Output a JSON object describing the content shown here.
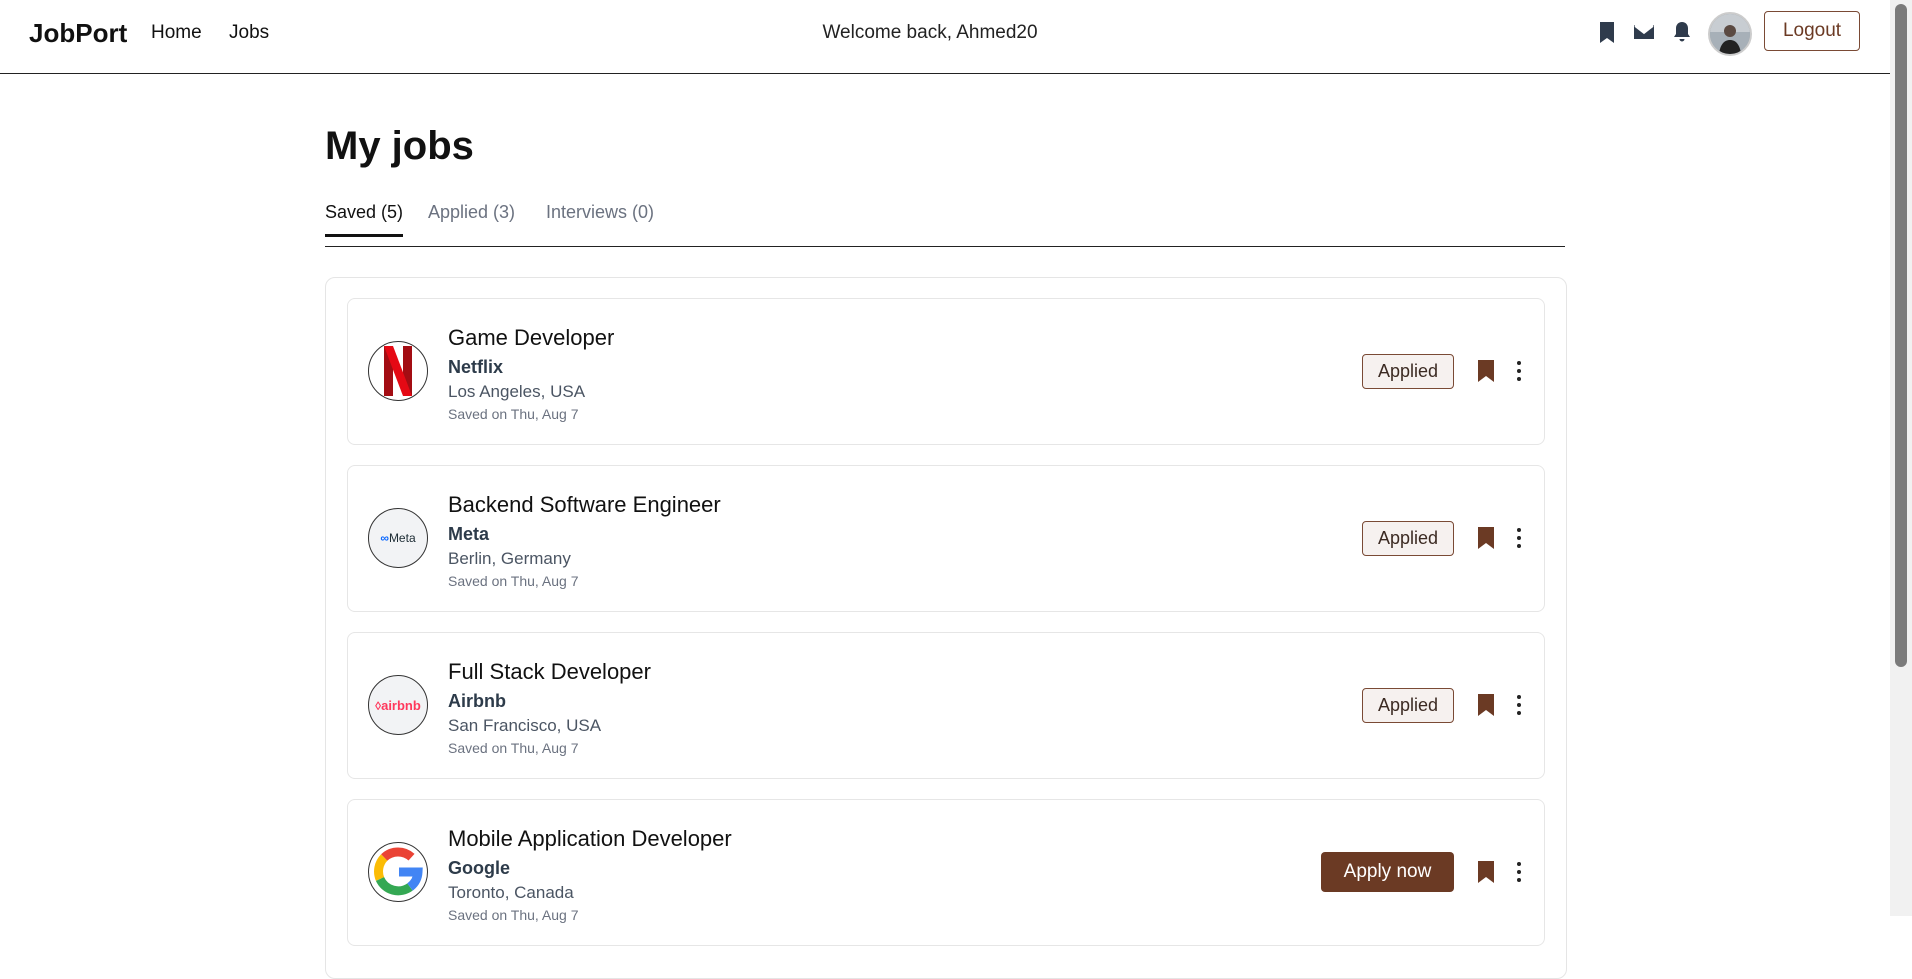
{
  "navbar": {
    "brand": "JobPort",
    "links": [
      "Home",
      "Jobs"
    ],
    "welcome": "Welcome back, Ahmed20",
    "icons": [
      "bookmark-icon",
      "mail-icon",
      "bell-icon"
    ],
    "logout": "Logout"
  },
  "page": {
    "title": "My jobs",
    "tabs": [
      "Saved (5)",
      "Applied (3)",
      "Interviews (0)"
    ],
    "active_tab": "Saved (5)"
  },
  "jobs": [
    {
      "title": "Game Developer",
      "company": "Netflix",
      "location": "Los Angeles, USA",
      "saved": "Saved on Thu, Aug 7",
      "status": "Applied",
      "logo": "netflix-logo"
    },
    {
      "title": "Backend Software Engineer",
      "company": "Meta",
      "location": "Berlin, Germany",
      "saved": "Saved on Thu, Aug 7",
      "status": "Applied",
      "logo": "meta-logo",
      "logo_text": "Meta"
    },
    {
      "title": "Full Stack Developer",
      "company": "Airbnb",
      "location": "San Francisco, USA",
      "saved": "Saved on Thu, Aug 7",
      "status": "Applied",
      "logo": "airbnb-logo",
      "logo_text": "airbnb"
    },
    {
      "title": "Mobile Application Developer",
      "company": "Google",
      "location": "Toronto, Canada",
      "saved": "Saved on Thu, Aug 7",
      "action": "Apply now",
      "logo": "google-logo"
    }
  ],
  "colors": {
    "accent": "#6b3a24",
    "icon": "#2f3b4c",
    "bookmark": "#6b3a24",
    "netflix_red": "#c4161c",
    "airbnb_pink": "#ff385c",
    "meta_blue": "#0866ff"
  }
}
